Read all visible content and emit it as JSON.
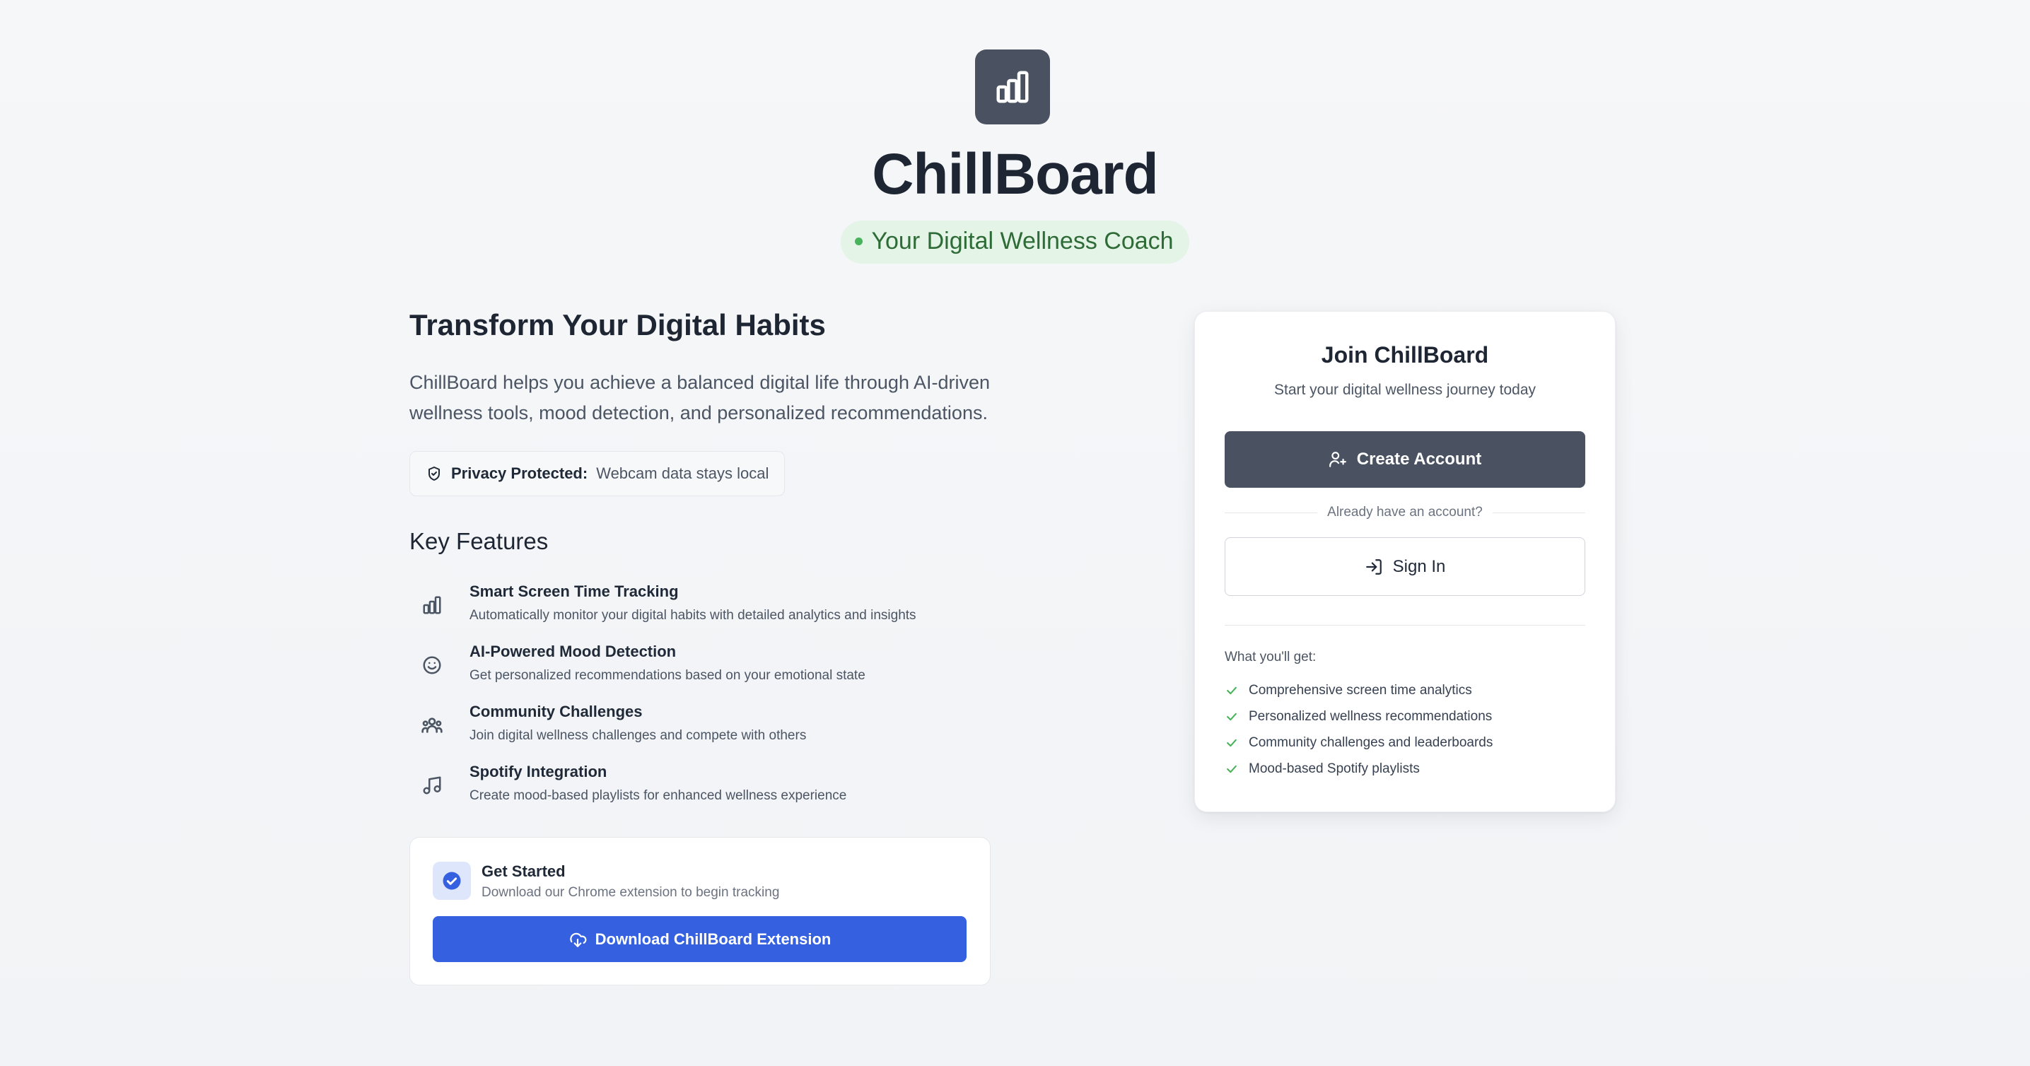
{
  "header": {
    "brand": "ChillBoard",
    "tagline": "Your Digital Wellness Coach",
    "logo_icon": "bar-chart-icon"
  },
  "hero": {
    "title": "Transform Your Digital Habits",
    "description": "ChillBoard helps you achieve a balanced digital life through AI-driven wellness tools, mood detection, and personalized recommendations.",
    "privacy_label": "Privacy Protected:",
    "privacy_text": "Webcam data stays local"
  },
  "features": {
    "title": "Key Features",
    "items": [
      {
        "icon": "bar-chart-icon",
        "title": "Smart Screen Time Tracking",
        "description": "Automatically monitor your digital habits with detailed analytics and insights"
      },
      {
        "icon": "smile-icon",
        "title": "AI-Powered Mood Detection",
        "description": "Get personalized recommendations based on your emotional state"
      },
      {
        "icon": "users-icon",
        "title": "Community Challenges",
        "description": "Join digital wellness challenges and compete with others"
      },
      {
        "icon": "music-icon",
        "title": "Spotify Integration",
        "description": "Create mood-based playlists for enhanced wellness experience"
      }
    ]
  },
  "get_started": {
    "title": "Get Started",
    "description": "Download our Chrome extension to begin tracking",
    "button_label": "Download ChillBoard Extension"
  },
  "join": {
    "title": "Join ChillBoard",
    "subtitle": "Start your digital wellness journey today",
    "create_label": "Create Account",
    "already_text": "Already have an account?",
    "signin_label": "Sign In",
    "benefits_title": "What you'll get:",
    "benefits": [
      "Comprehensive screen time analytics",
      "Personalized wellness recommendations",
      "Community challenges and leaderboards",
      "Mood-based Spotify playlists"
    ]
  },
  "colors": {
    "primary_dark": "#4a5261",
    "accent_blue": "#3561e1",
    "tagline_bg": "#e4f4e6",
    "tagline_text": "#2e6b37",
    "check_green": "#47b35a"
  }
}
